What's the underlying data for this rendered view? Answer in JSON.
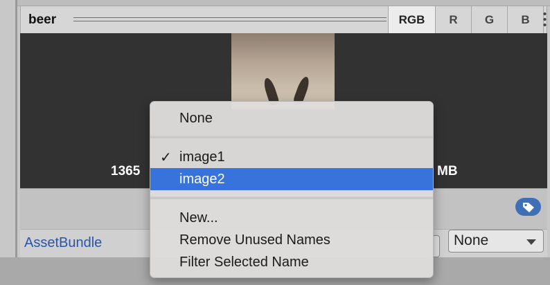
{
  "header": {
    "title": "beer",
    "channels": [
      "RGB",
      "R",
      "G",
      "B"
    ],
    "active_channel": "RGB"
  },
  "preview": {
    "info_left": "1365",
    "info_right": "MB"
  },
  "assetbundle": {
    "label": "AssetBundle",
    "variant_value": "None"
  },
  "menu": {
    "none_label": "None",
    "items": [
      {
        "label": "image1",
        "checked": true
      },
      {
        "label": "image2",
        "highlighted": true
      }
    ],
    "actions": [
      "New...",
      "Remove Unused Names",
      "Filter Selected Name"
    ]
  },
  "icons": {
    "menu": "vertical-ellipsis-icon",
    "tag": "tag-icon",
    "check": "checkmark-icon",
    "dropdown": "chevron-down-icon"
  },
  "colors": {
    "selection": "#3873dc",
    "link_blue": "#2a55a8",
    "tag_badge": "#3f6fb5",
    "preview_bg": "#323232"
  }
}
